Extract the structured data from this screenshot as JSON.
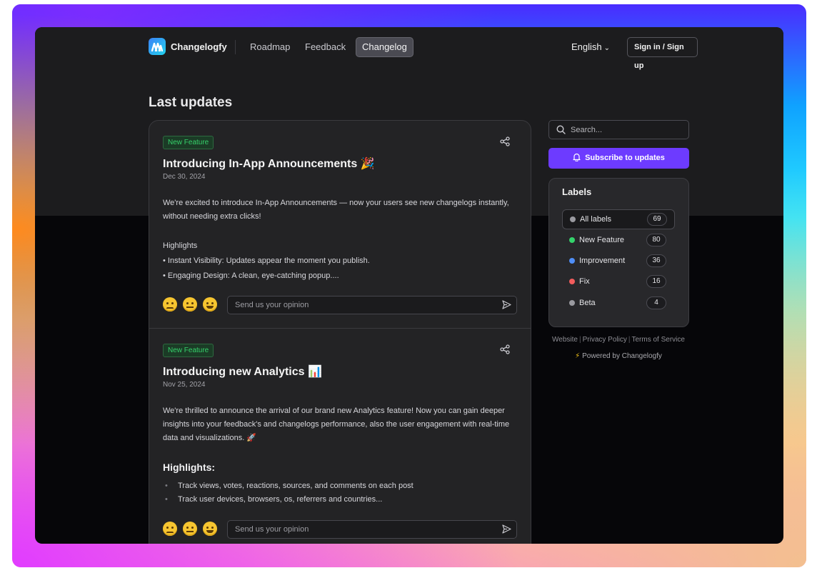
{
  "nav": {
    "brand": "Changelogfy",
    "links": [
      "Roadmap",
      "Feedback",
      "Changelog"
    ],
    "active": "Changelog",
    "language": "English",
    "signin": "Sign in / Sign up"
  },
  "page_title": "Last updates",
  "posts": [
    {
      "badge": "New Feature",
      "title": "Introducing In-App Announcements 🎉",
      "date": "Dec 30, 2024",
      "body": "We're excited to introduce In-App Announcements — now your users see new changelogs instantly, without needing extra clicks!",
      "highlights_label": "Highlights",
      "bullets": [
        "• Instant Visibility: Updates appear the moment you publish.",
        "• Engaging Design: A clean, eye-catching popup...."
      ],
      "opinion_placeholder": "Send us your opinion"
    },
    {
      "badge": "New Feature",
      "title": "Introducing new Analytics 📊",
      "date": "Nov 25, 2024",
      "body": "We're thrilled to announce the arrival of our brand new Analytics feature! Now you can gain deeper insights into your feedback's and changelogs performance, also the user engagement with real-time data and visualizations. 🚀",
      "highlights_label": "Highlights:",
      "bullets": [
        "Track views, votes, reactions, sources, and comments on each post",
        "Track user devices, browsers, os, referrers and countries..."
      ],
      "opinion_placeholder": "Send us your opinion"
    }
  ],
  "sidebar": {
    "search_placeholder": "Search...",
    "subscribe": "Subscribe to updates",
    "labels_title": "Labels",
    "labels": [
      {
        "name": "All labels",
        "count": "69",
        "color": "#9a9aa0"
      },
      {
        "name": "New Feature",
        "count": "80",
        "color": "#34d36b"
      },
      {
        "name": "Improvement",
        "count": "36",
        "color": "#4f8ef7"
      },
      {
        "name": "Fix",
        "count": "16",
        "color": "#f25c5c"
      },
      {
        "name": "Beta",
        "count": "4",
        "color": "#9a9aa0"
      }
    ],
    "footer_links": [
      "Website",
      "Privacy Policy",
      "Terms of Service"
    ],
    "powered": "Powered by Changelogfy"
  },
  "colors": {
    "accent": "#6d3bff",
    "badge_text": "#36d26b"
  }
}
